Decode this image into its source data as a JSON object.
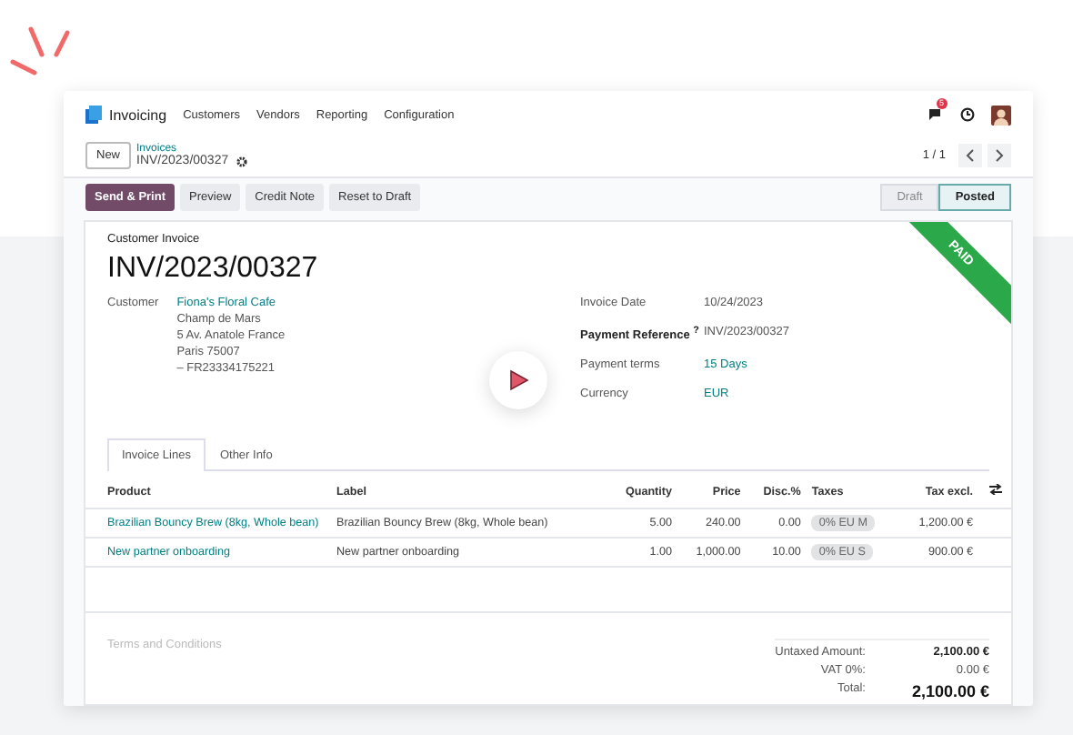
{
  "app": {
    "name": "Invoicing",
    "menu": [
      "Customers",
      "Vendors",
      "Reporting",
      "Configuration"
    ],
    "notification_count": "5"
  },
  "breadcrumb": {
    "new_button": "New",
    "parent": "Invoices",
    "current": "INV/2023/00327",
    "pager": "1 / 1"
  },
  "actions": [
    {
      "label": "Send & Print",
      "primary": true
    },
    {
      "label": "Preview",
      "primary": false
    },
    {
      "label": "Credit Note",
      "primary": false
    },
    {
      "label": "Reset to Draft",
      "primary": false
    }
  ],
  "status_steps": [
    {
      "label": "Draft",
      "selected": false
    },
    {
      "label": "Posted",
      "selected": true
    }
  ],
  "invoice": {
    "type": "Customer Invoice",
    "number": "INV/2023/00327",
    "ribbon": "PAID",
    "customer_label": "Customer",
    "customer_name": "Fiona's Floral Cafe",
    "address": [
      "Champ de Mars",
      "5 Av. Anatole France",
      "Paris 75007",
      "– FR23334175221"
    ],
    "fields": [
      {
        "label": "Invoice Date",
        "value": "10/24/2023",
        "bold": false,
        "link": false
      },
      {
        "label": "Payment Reference $^{?}$",
        "value": "INV/2023/00327",
        "bold": true,
        "link": false
      },
      {
        "label": "Payment terms",
        "value": "15 Days",
        "bold": false,
        "link": true
      },
      {
        "label": "Currency",
        "value": "EUR",
        "bold": false,
        "link": true
      }
    ]
  },
  "tabs": [
    {
      "label": "Invoice Lines",
      "selected": true
    },
    {
      "label": "Other Info",
      "selected": false
    }
  ],
  "table": {
    "columns": [
      "Product",
      "Label",
      "Quantity",
      "Price",
      "Disc.%",
      "Taxes",
      "Tax excl."
    ],
    "rows": [
      {
        "product": "Brazilian Bouncy Brew (8kg, Whole bean)",
        "label": "Brazilian Bouncy Brew (8kg, Whole bean)",
        "quantity": "5.00",
        "price": "240.00",
        "discount": "0.00",
        "tax": "0% EU M",
        "subtotal": "1,200.00 €"
      },
      {
        "product": "New partner onboarding",
        "label": "New partner onboarding",
        "quantity": "1.00",
        "price": "1,000.00",
        "discount": "10.00",
        "tax": "0% EU S",
        "subtotal": "900.00 €"
      }
    ]
  },
  "terms_placeholder": "Terms and Conditions",
  "totals": [
    {
      "label": "Untaxed Amount:",
      "value": "2,100.00 €",
      "kind": "subtotal"
    },
    {
      "label": "VAT 0%:",
      "value": "0.00 €",
      "kind": "tax"
    },
    {
      "label": "Total:",
      "value": "2,100.00 €",
      "kind": "total"
    }
  ]
}
